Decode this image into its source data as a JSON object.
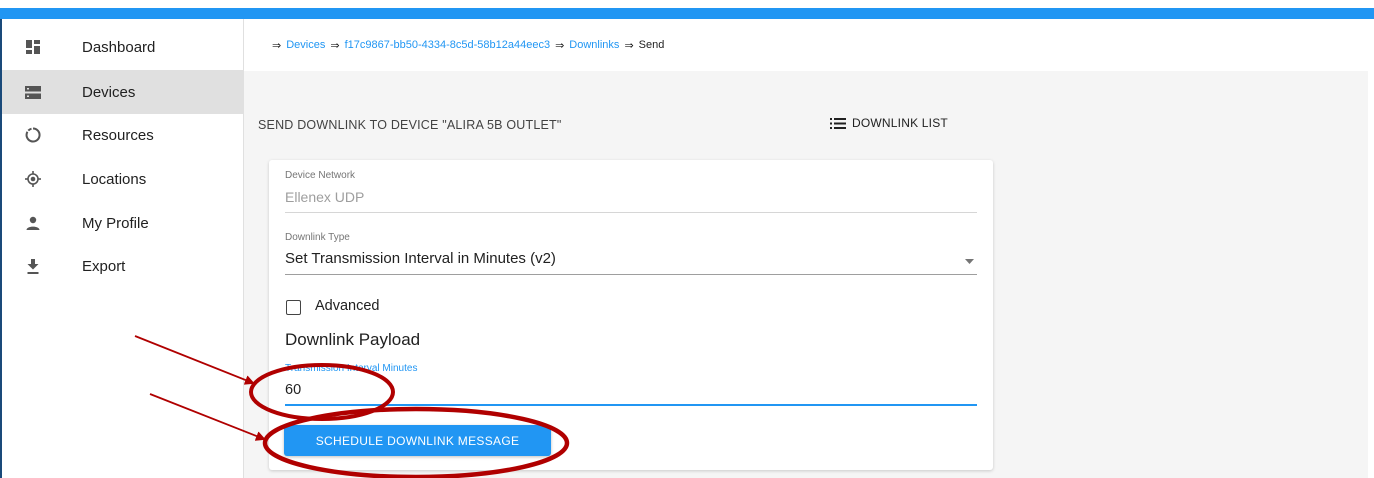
{
  "colors": {
    "accent": "#2196f3",
    "annotation": "#b00000",
    "active_nav": "#e0e0e0"
  },
  "sidebar": {
    "items": [
      {
        "label": "Dashboard",
        "icon": "dashboard-icon",
        "active": false
      },
      {
        "label": "Devices",
        "icon": "devices-icon",
        "active": true
      },
      {
        "label": "Resources",
        "icon": "resources-icon",
        "active": false
      },
      {
        "label": "Locations",
        "icon": "locations-icon",
        "active": false
      },
      {
        "label": "My Profile",
        "icon": "person-icon",
        "active": false
      },
      {
        "label": "Export",
        "icon": "download-icon",
        "active": false
      }
    ]
  },
  "breadcrumb": {
    "separator": "⇒",
    "items": [
      "Devices",
      "f17c9867-bb50-4334-8c5d-58b12a44eec3",
      "Downlinks",
      "Send"
    ]
  },
  "page": {
    "title": "SEND DOWNLINK TO DEVICE \"ALIRA 5B OUTLET\"",
    "downlink_list_label": "DOWNLINK LIST"
  },
  "form": {
    "device_network": {
      "label": "Device Network",
      "value": "Ellenex UDP"
    },
    "downlink_type": {
      "label": "Downlink Type",
      "value": "Set Transmission Interval in Minutes (v2)"
    },
    "advanced": {
      "label": "Advanced",
      "checked": false
    },
    "payload_title": "Downlink Payload",
    "interval": {
      "label": "Transmission Interval Minutes",
      "value": "60"
    },
    "submit_label": "SCHEDULE DOWNLINK MESSAGE"
  }
}
